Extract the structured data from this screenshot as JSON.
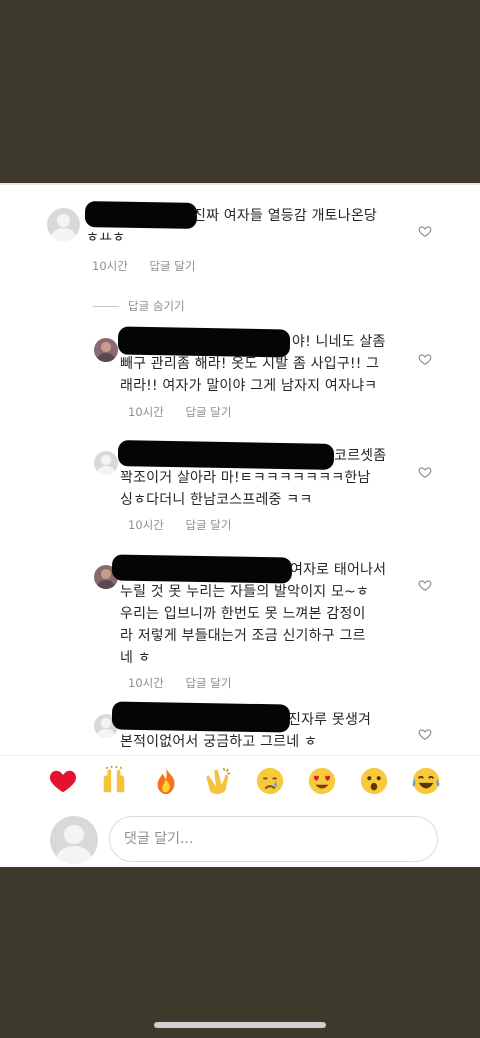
{
  "comments": [
    {
      "text_line1": "진짜 여자들 열등감 개토나온당",
      "text_line2": "ㅎㅛㅎ",
      "time": "10시간",
      "reply": "답글 달기"
    }
  ],
  "hide_replies_label": "답글 숨기기",
  "replies": [
    {
      "lines": [
        "야! 니네도 살좀",
        "빼구 관리좀 해라! 옷도 시발 좀 사입구!! 그",
        "래라!! 여자가 말이야 그게 남자지 여자냐ㅋ"
      ],
      "time": "10시간",
      "reply": "답글 달기"
    },
    {
      "lines": [
        "코르셋좀",
        "꽉조이거 살아라 마!ㅌㅋㅋㅋㅋㅋㅋㅋ한남",
        "싱ㅎ다더니 한남코스프레중 ㅋㅋ"
      ],
      "time": "10시간",
      "reply": "답글 달기"
    },
    {
      "lines": [
        "여자로 태어나서",
        "누릴 것 못 누리는 자들의 발악이지 모~ㅎ",
        "우리는 입브니까 한번도 못 느껴본 감정이",
        "라 저렇게 부들대는거 조금 신기하구 그르",
        "네 ㅎ"
      ],
      "time": "10시간",
      "reply": "답글 달기"
    },
    {
      "lines": [
        "진자루 못생겨",
        "본적이없어서 궁금하고 그르네 ㅎ"
      ]
    }
  ],
  "emoji_bar": [
    "red-heart",
    "raising-hands",
    "fire",
    "clapping-hands",
    "crying-face",
    "heart-eyes-face",
    "astonished-face",
    "tears-of-joy-face"
  ],
  "compose": {
    "placeholder": "댓글 달기..."
  },
  "colors": {
    "frame": "#3d3a2c",
    "text": "#262626",
    "muted": "#8e8e8e"
  }
}
